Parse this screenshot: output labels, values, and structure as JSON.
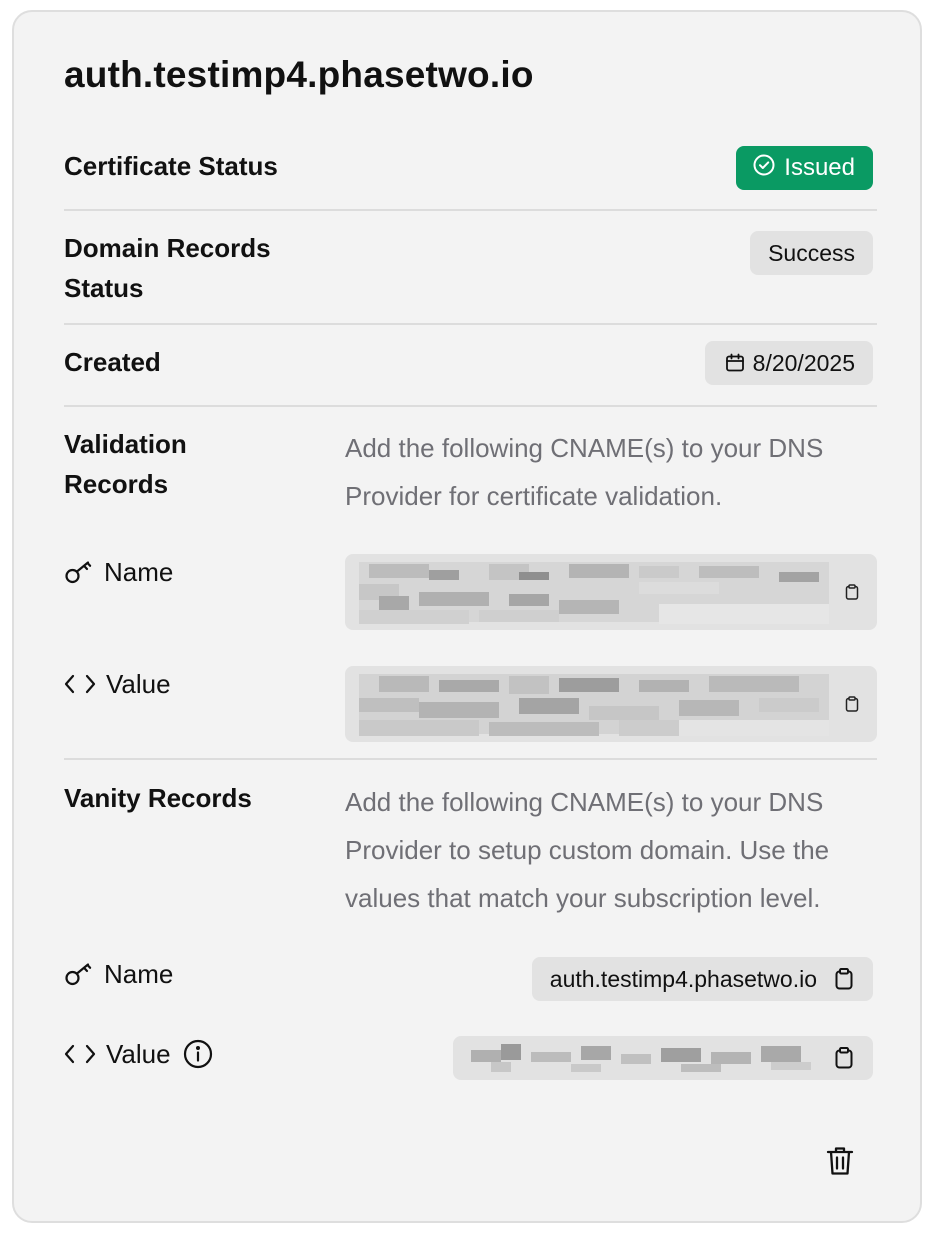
{
  "domain_title": "auth.testimp4.phasetwo.io",
  "certificate_status": {
    "label": "Certificate Status",
    "badge": "Issued",
    "badge_color": "#0a9a63"
  },
  "domain_records_status": {
    "label_line1": "Domain Records",
    "label_line2": "Status",
    "badge": "Success"
  },
  "created": {
    "label": "Created",
    "date": "8/20/2025"
  },
  "validation_records": {
    "label_line1": "Validation",
    "label_line2": "Records",
    "description": "Add the following CNAME(s) to your DNS Provider for certificate validation.",
    "name_label": "Name",
    "value_label": "Value"
  },
  "vanity_records": {
    "label": "Vanity Records",
    "description": "Add the following CNAME(s) to your DNS Provider to setup custom domain. Use the values that match your subscription level.",
    "name_label": "Name",
    "name_value": "auth.testimp4.phasetwo.io",
    "value_label": "Value"
  },
  "icons": [
    "check-circle-icon",
    "calendar-icon",
    "key-icon",
    "code-icon",
    "copy-icon",
    "info-icon",
    "trash-icon"
  ]
}
